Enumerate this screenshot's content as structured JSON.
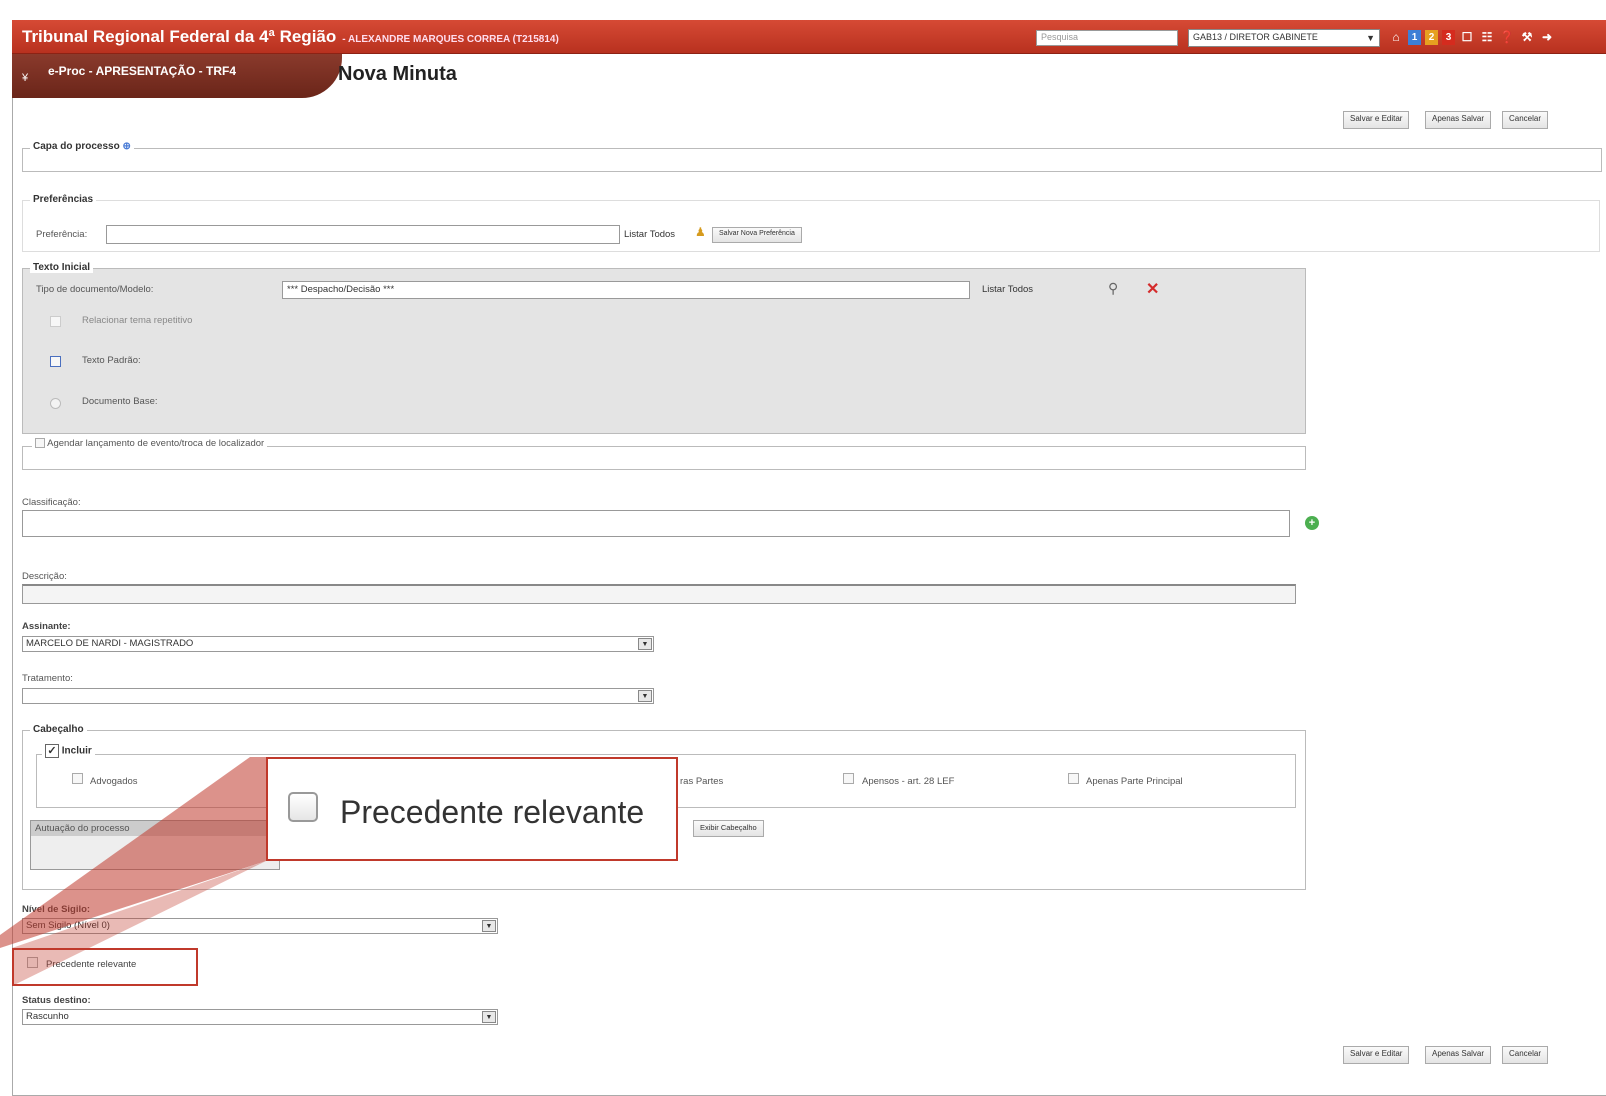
{
  "header": {
    "org_title": "Tribunal Regional Federal da 4ª Região",
    "user": "- ALEXANDRE MARQUES CORREA (T215814)",
    "search_placeholder": "Pesquisa",
    "unit_selector": "GAB13 / DIRETOR GABINETE",
    "badges": [
      "1",
      "2",
      "3"
    ],
    "icons": [
      "home-icon",
      "calendar-icon",
      "grid-icon",
      "help-icon",
      "wrench-icon",
      "exit-icon"
    ]
  },
  "menubar": {
    "system": "e-Proc - APRESENTAÇÃO - TRF4",
    "page_title": "Nova Minuta"
  },
  "actions": {
    "save_edit": "Salvar e Editar",
    "save_only": "Apenas Salvar",
    "cancel": "Cancelar"
  },
  "capa": {
    "legend": "Capa do processo",
    "toggle": "⊕"
  },
  "preferencias": {
    "legend": "Preferências",
    "label": "Preferência:",
    "list_all": "Listar Todos",
    "save_new": "Salvar Nova Preferência"
  },
  "texto_inicial": {
    "legend": "Texto Inicial",
    "tipo_label": "Tipo de documento/Modelo:",
    "tipo_value": "*** Despacho/Decisão ***",
    "list_all": "Listar Todos",
    "relacionar": "Relacionar tema repetitivo",
    "texto_padrao": "Texto Padrão:",
    "documento_base": "Documento Base:"
  },
  "agendar": {
    "label": "Agendar lançamento de evento/troca de localizador"
  },
  "classificacao": {
    "label": "Classificação:"
  },
  "descricao": {
    "label": "Descrição:"
  },
  "assinante": {
    "label": "Assinante:",
    "value": "MARCELO DE NARDI - MAGISTRADO"
  },
  "tratamento": {
    "label": "Tratamento:",
    "value": ""
  },
  "cabecalho": {
    "legend": "Cabeçalho",
    "incluir": "Incluir",
    "options": [
      "Advogados",
      "ras Partes",
      "Apensos - art. 28 LEF",
      "Apenas Parte Principal"
    ],
    "autuacao": "Autuação do processo",
    "exibir": "Exibir Cabeçalho"
  },
  "sigilo": {
    "label": "Nível de Sigilo:",
    "value": "Sem Sigilo (Nível 0)"
  },
  "precedente": {
    "label": "Precedente relevante"
  },
  "status": {
    "label": "Status destino:",
    "value": "Rascunho"
  },
  "callout": {
    "text": "Precedente relevante"
  },
  "colors": {
    "brand_red": "#c23a25",
    "dark_red": "#7a2b1e",
    "highlight": "#c0392b"
  }
}
